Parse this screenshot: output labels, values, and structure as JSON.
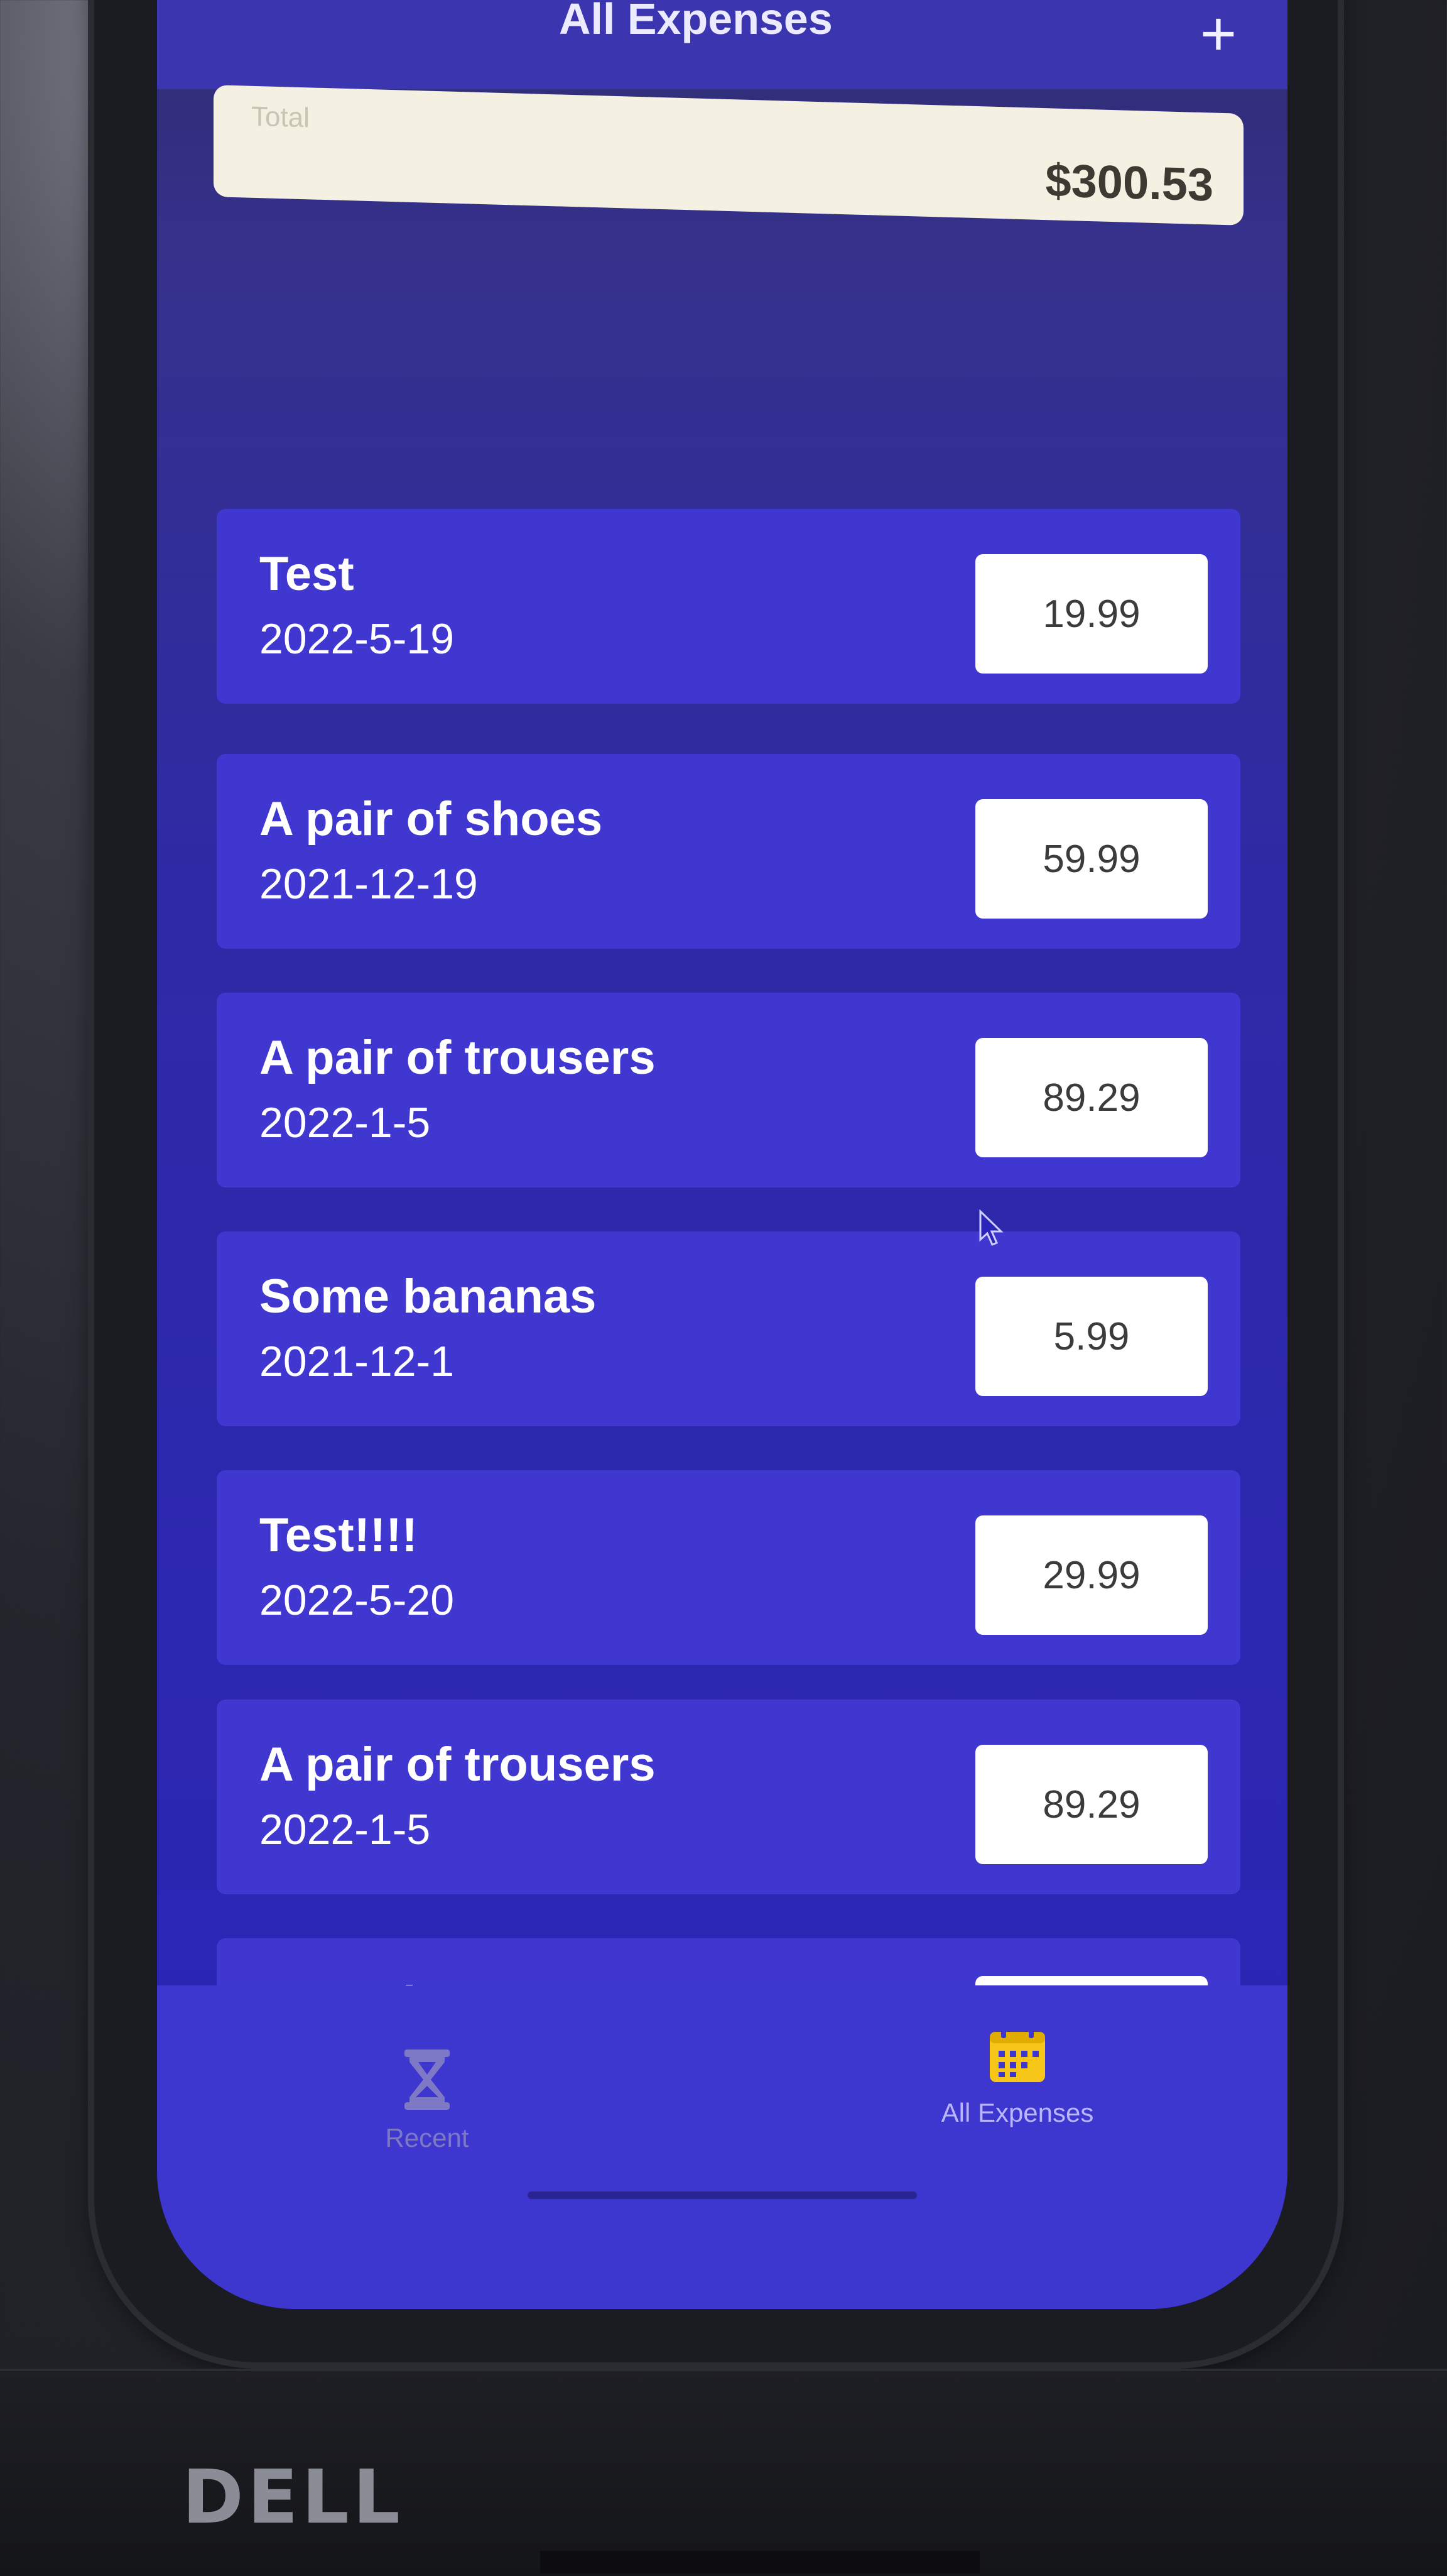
{
  "header": {
    "title": "All Expenses",
    "add_label": "+"
  },
  "summary": {
    "label": "Total",
    "value": "$300.53"
  },
  "expenses": [
    {
      "title": "Test",
      "date": "2022-5-19",
      "amount": "19.99"
    },
    {
      "title": "A pair of shoes",
      "date": "2021-12-19",
      "amount": "59.99"
    },
    {
      "title": "A pair of trousers",
      "date": "2022-1-5",
      "amount": "89.29"
    },
    {
      "title": "Some bananas",
      "date": "2021-12-1",
      "amount": "5.99"
    },
    {
      "title": "Test!!!!",
      "date": "2022-5-20",
      "amount": "29.99"
    },
    {
      "title": "A pair of trousers",
      "date": "2022-1-5",
      "amount": "89.29"
    },
    {
      "title": "Some bananas",
      "date": "",
      "amount": ""
    }
  ],
  "tabs": [
    {
      "label": "Recent",
      "icon": "hourglass-icon",
      "active": false
    },
    {
      "label": "All Expenses",
      "icon": "calendar-icon",
      "active": true
    }
  ],
  "device": {
    "brand": "DELL"
  },
  "colors": {
    "header": "#3b36b0",
    "card": "#3f37cf",
    "accent": "#f5c518",
    "background": "#2a24b8"
  }
}
